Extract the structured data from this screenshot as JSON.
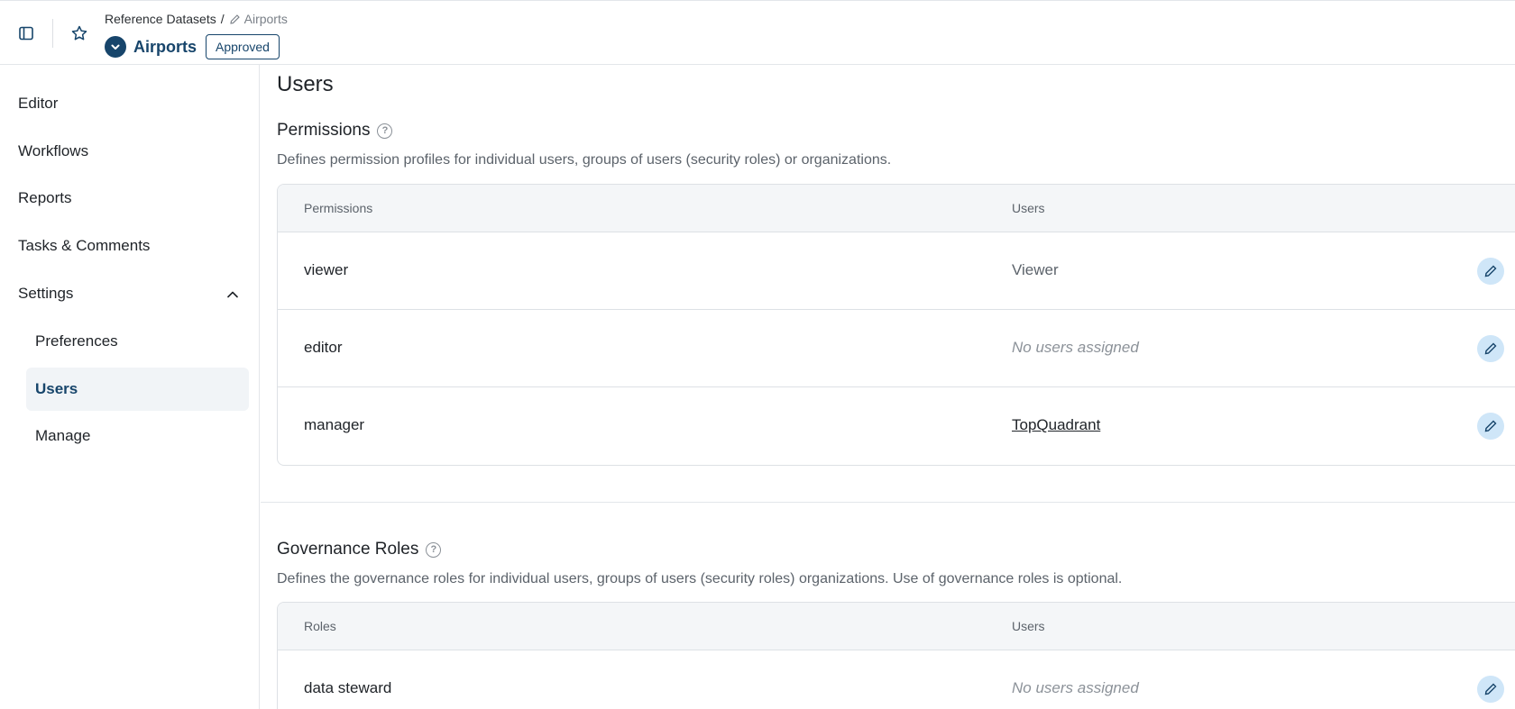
{
  "header": {
    "breadcrumb_parent": "Reference Datasets",
    "breadcrumb_separator": "/",
    "breadcrumb_current": "Airports",
    "title": "Airports",
    "status_badge": "Approved"
  },
  "sidebar": {
    "items": [
      {
        "label": "Editor"
      },
      {
        "label": "Workflows"
      },
      {
        "label": "Reports"
      },
      {
        "label": "Tasks & Comments"
      },
      {
        "label": "Settings"
      }
    ],
    "settings_sub": [
      {
        "label": "Preferences"
      },
      {
        "label": "Users"
      },
      {
        "label": "Manage"
      }
    ]
  },
  "main": {
    "page_title": "Users",
    "permissions": {
      "title": "Permissions",
      "description": "Defines permission profiles for individual users, groups of users (security roles) or organizations.",
      "col1": "Permissions",
      "col2": "Users",
      "rows": [
        {
          "name": "viewer",
          "users": "Viewer"
        },
        {
          "name": "editor",
          "users": "No users assigned"
        },
        {
          "name": "manager",
          "users": "TopQuadrant"
        }
      ]
    },
    "governance": {
      "title": "Governance Roles",
      "description": "Defines the governance roles for individual users, groups of users (security roles) organizations. Use of governance roles is optional.",
      "col1": "Roles",
      "col2": "Users",
      "rows": [
        {
          "name": "data steward",
          "users": "No users assigned"
        }
      ]
    }
  },
  "colors": {
    "brand": "#17456b",
    "active_bg": "#f1f4f7",
    "edit_bg": "#cfe6f8"
  }
}
